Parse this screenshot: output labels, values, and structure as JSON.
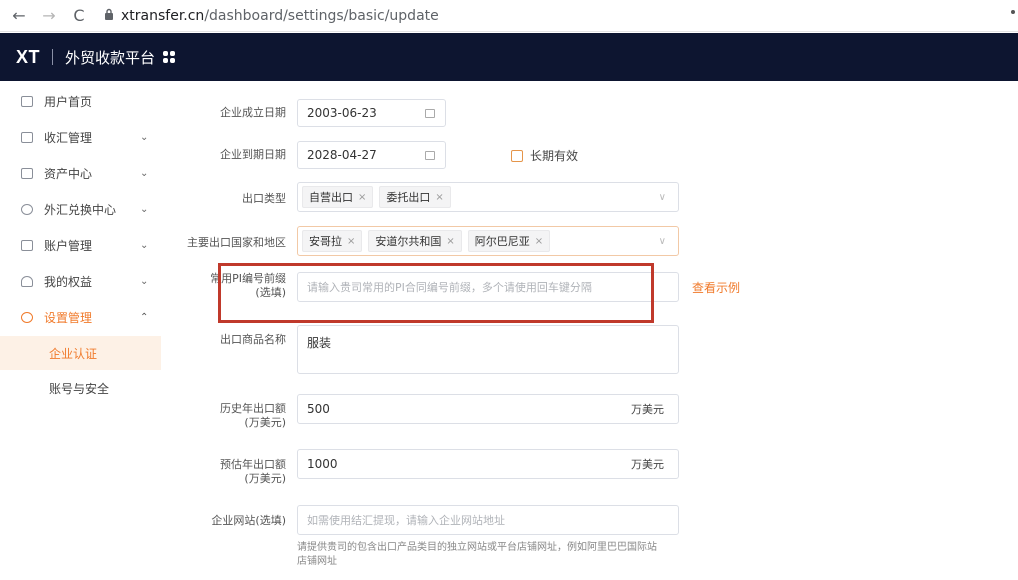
{
  "browser": {
    "back_icon": "←",
    "forward_icon": "→",
    "reload_icon": "C",
    "lock_icon": "🔒",
    "url_domain": "xtransfer.cn",
    "url_path": "/dashboard/settings/basic/update"
  },
  "header": {
    "logo": "XT",
    "platform": "外贸收款平台"
  },
  "sidebar": {
    "items": [
      {
        "label": "用户首页",
        "chevron": ""
      },
      {
        "label": "收汇管理",
        "chevron": "⌄"
      },
      {
        "label": "资产中心",
        "chevron": "⌄"
      },
      {
        "label": "外汇兑换中心",
        "chevron": "⌄"
      },
      {
        "label": "账户管理",
        "chevron": "⌄"
      },
      {
        "label": "我的权益",
        "chevron": "⌄"
      },
      {
        "label": "设置管理",
        "chevron": "⌃"
      }
    ],
    "sub_items": [
      {
        "label": "企业认证"
      },
      {
        "label": "账号与安全"
      }
    ]
  },
  "form": {
    "establish_date": {
      "label": "企业成立日期",
      "value": "2003-06-23"
    },
    "expiry_date": {
      "label": "企业到期日期",
      "value": "2028-04-27",
      "long_term_label": "长期有效"
    },
    "export_type": {
      "label": "出口类型",
      "tags": [
        "自营出口",
        "委托出口"
      ]
    },
    "export_countries": {
      "label": "主要出口国家和地区",
      "tags": [
        "安哥拉",
        "安道尔共和国",
        "阿尔巴尼亚"
      ]
    },
    "pi_prefix": {
      "label_line1": "常用PI编号前缀",
      "label_line2": "(选填)",
      "placeholder": "请输入贵司常用的PI合同编号前缀，多个请使用回车键分隔",
      "example_link": "查看示例"
    },
    "product_name": {
      "label": "出口商品名称",
      "value": "服装"
    },
    "history_export": {
      "label_line1": "历史年出口额",
      "label_line2": "(万美元)",
      "value": "500",
      "unit": "万美元"
    },
    "estimated_export": {
      "label_line1": "预估年出口额",
      "label_line2": "(万美元)",
      "value": "1000",
      "unit": "万美元"
    },
    "website": {
      "label": "企业网站(选填)",
      "placeholder": "如需使用结汇提现，请输入企业网站地址",
      "hint_line1": "请提供贵司的包含出口产品类目的独立网站或平台店铺网址，例如阿里巴巴国际站",
      "hint_line2": "店铺网址"
    }
  },
  "colors": {
    "accent": "#f07a2b",
    "header_bg": "#0d1530",
    "highlight_box": "#c0392b"
  }
}
